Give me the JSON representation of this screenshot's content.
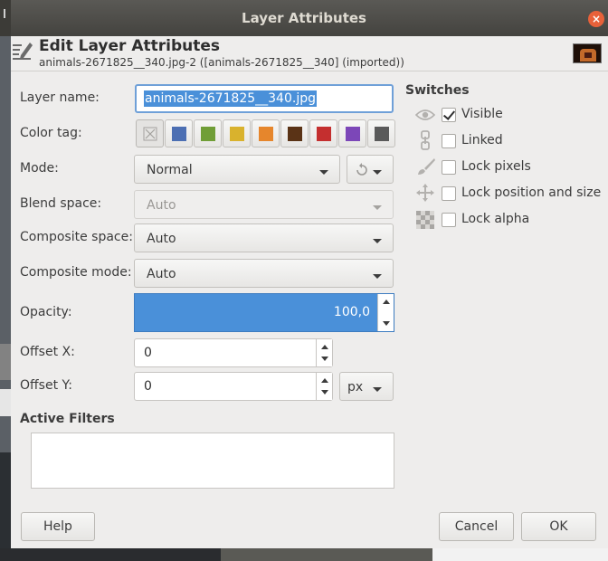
{
  "window": {
    "title": "Layer Attributes",
    "close_glyph": "×"
  },
  "header": {
    "title": "Edit Layer Attributes",
    "subtitle": "animals-2671825__340.jpg-2 ([animals-2671825__340] (imported))",
    "icon": "edit-layer-icon"
  },
  "form": {
    "layer_name_label": "Layer name:",
    "layer_name_value": "animals-2671825__340.jpg",
    "color_tag_label": "Color tag:",
    "color_tags": [
      {
        "name": "none",
        "color": ""
      },
      {
        "name": "blue",
        "color": "#4c6fb3"
      },
      {
        "name": "green",
        "color": "#709e37"
      },
      {
        "name": "yellow",
        "color": "#d9b22d"
      },
      {
        "name": "orange",
        "color": "#e6862c"
      },
      {
        "name": "brown",
        "color": "#5a3316"
      },
      {
        "name": "red",
        "color": "#c42f2f"
      },
      {
        "name": "violet",
        "color": "#7c47b8"
      },
      {
        "name": "gray",
        "color": "#5a5a5a"
      }
    ],
    "mode_label": "Mode:",
    "mode_value": "Normal",
    "blend_space_label": "Blend space:",
    "blend_space_value": "Auto",
    "composite_space_label": "Composite space:",
    "composite_space_value": "Auto",
    "composite_mode_label": "Composite mode:",
    "composite_mode_value": "Auto",
    "opacity_label": "Opacity:",
    "opacity_value": "100,0",
    "offset_x_label": "Offset X:",
    "offset_x_value": "0",
    "offset_y_label": "Offset Y:",
    "offset_y_value": "0",
    "unit_value": "px",
    "active_filters_label": "Active Filters"
  },
  "switches": {
    "title": "Switches",
    "items": [
      {
        "label": "Visible",
        "checked": true,
        "icon": "eye-icon"
      },
      {
        "label": "Linked",
        "checked": false,
        "icon": "chain-icon"
      },
      {
        "label": "Lock pixels",
        "checked": false,
        "icon": "paintbrush-icon"
      },
      {
        "label": "Lock position and size",
        "checked": false,
        "icon": "move-icon"
      },
      {
        "label": "Lock alpha",
        "checked": false,
        "icon": "checkerboard-icon"
      }
    ]
  },
  "buttons": {
    "help": "Help",
    "cancel": "Cancel",
    "ok": "OK"
  }
}
